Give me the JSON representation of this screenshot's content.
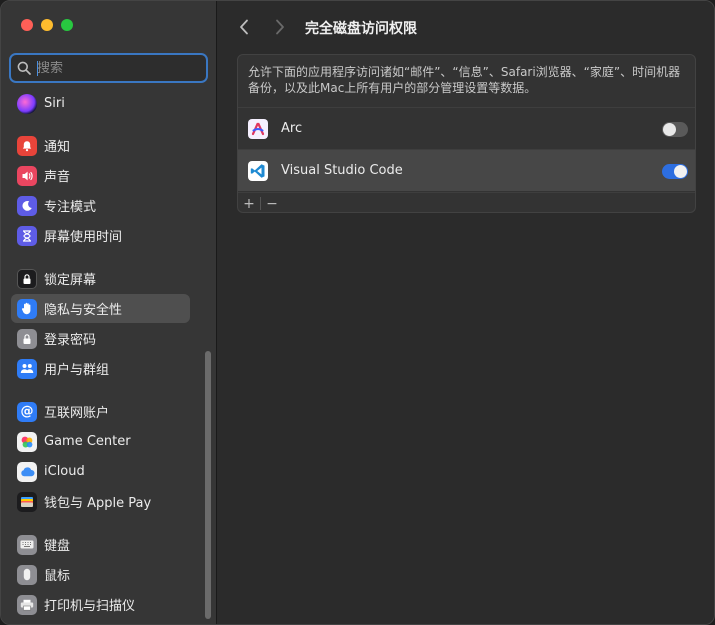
{
  "search": {
    "placeholder": "搜索"
  },
  "sidebar": {
    "items": [
      {
        "label": "Siri"
      },
      {
        "label": "通知"
      },
      {
        "label": "声音"
      },
      {
        "label": "专注模式"
      },
      {
        "label": "屏幕使用时间"
      },
      {
        "label": "锁定屏幕"
      },
      {
        "label": "隐私与安全性",
        "selected": true
      },
      {
        "label": "登录密码"
      },
      {
        "label": "用户与群组"
      },
      {
        "label": "互联网账户"
      },
      {
        "label": "Game Center"
      },
      {
        "label": "iCloud"
      },
      {
        "label": "钱包与 Apple Pay"
      },
      {
        "label": "键盘"
      },
      {
        "label": "鼠标"
      },
      {
        "label": "打印机与扫描仪"
      }
    ]
  },
  "main": {
    "title": "完全磁盘访问权限",
    "description": "允许下面的应用程序访问诸如“邮件”、“信息”、Safari浏览器、“家庭”、时间机器备份，以及此Mac上所有用户的部分管理设置等数据。",
    "apps": [
      {
        "name": "Arc",
        "enabled": false
      },
      {
        "name": "Visual Studio Code",
        "enabled": true
      }
    ],
    "add_label": "+",
    "remove_label": "−"
  },
  "colors": {
    "accent": "#2d6ee0",
    "selection": "#4f4f4f"
  }
}
